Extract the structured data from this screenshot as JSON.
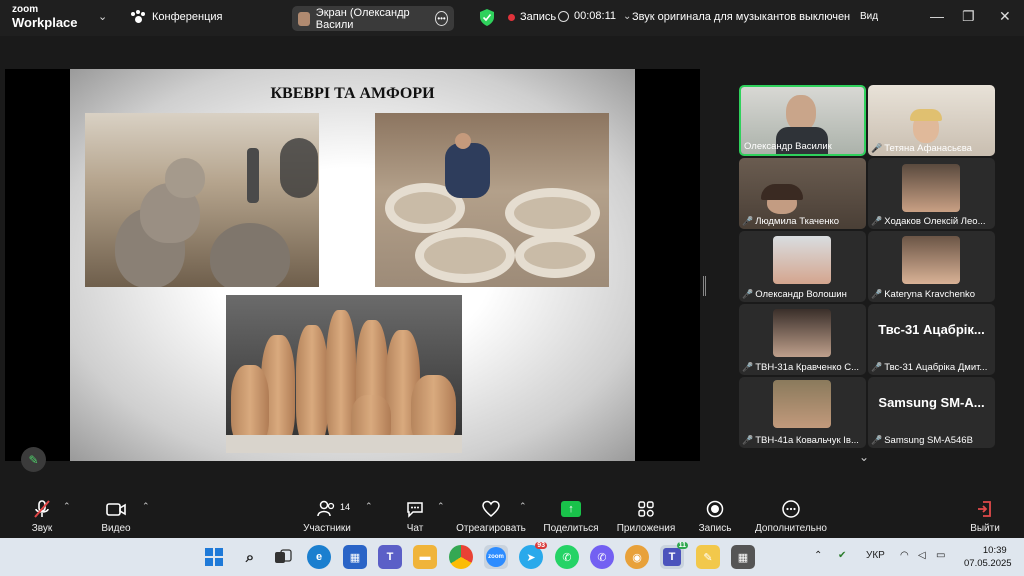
{
  "titlebar": {
    "brand_line1": "zoom",
    "brand_line2": "Workplace",
    "conference_label": "Конференция",
    "screen_share_label": "Экран (Олександр Васили",
    "recording_label": "Запись",
    "timer": "00:08:11",
    "original_sound_label": "Звук оригинала для музыкантов выключен",
    "view_label": "Вид",
    "minimize": "—",
    "restore": "❐",
    "close": "✕"
  },
  "slide": {
    "title": "КВЕВРІ ТА АМФОРИ"
  },
  "participants": [
    {
      "name": "Олександр Василик",
      "muted": false,
      "active": true,
      "mic": ""
    },
    {
      "name": "Тетяна Афанасьєва",
      "muted": true,
      "mic": "🎤"
    },
    {
      "name": "Людмила Ткаченко",
      "muted": true,
      "mic": "🎤"
    },
    {
      "name": "Ходаков Олексій Лео...",
      "muted": true,
      "mic": "🎤"
    },
    {
      "name": "Олександр Волошин",
      "muted": true,
      "mic": "🎤"
    },
    {
      "name": "Kateryna Kravchenko",
      "muted": true,
      "mic": "🎤"
    },
    {
      "name": "ТВН-31а Кравченко С...",
      "muted": true,
      "mic": "🎤"
    },
    {
      "name": "Твс-31 Ацабріка Дмит...",
      "muted": true,
      "display": "Твс-31  Ацабрік...",
      "mic": "🎤"
    },
    {
      "name": "ТВН-41а Ковальчук Ів...",
      "muted": true,
      "mic": "🎤"
    },
    {
      "name": "Samsung SM-A546B",
      "muted": true,
      "display": "Samsung  SM-A...",
      "mic": "🎤"
    }
  ],
  "toolbar": {
    "audio_label": "Звук",
    "video_label": "Видео",
    "participants_label": "Участники",
    "participants_count": "14",
    "chat_label": "Чат",
    "react_label": "Отреагировать",
    "share_label": "Поделиться",
    "apps_label": "Приложения",
    "record_label": "Запись",
    "more_label": "Дополнительно",
    "leave_label": "Выйти"
  },
  "taskbar": {
    "telegram_badge": "93",
    "teams_badge": "11",
    "language": "УКР",
    "time": "10:39",
    "date": "07.05.2025"
  },
  "colors": {
    "active_speaker": "#2fd15c",
    "share_green": "#19c24a",
    "record_red": "#e0333b",
    "muted_red": "#e34848"
  }
}
